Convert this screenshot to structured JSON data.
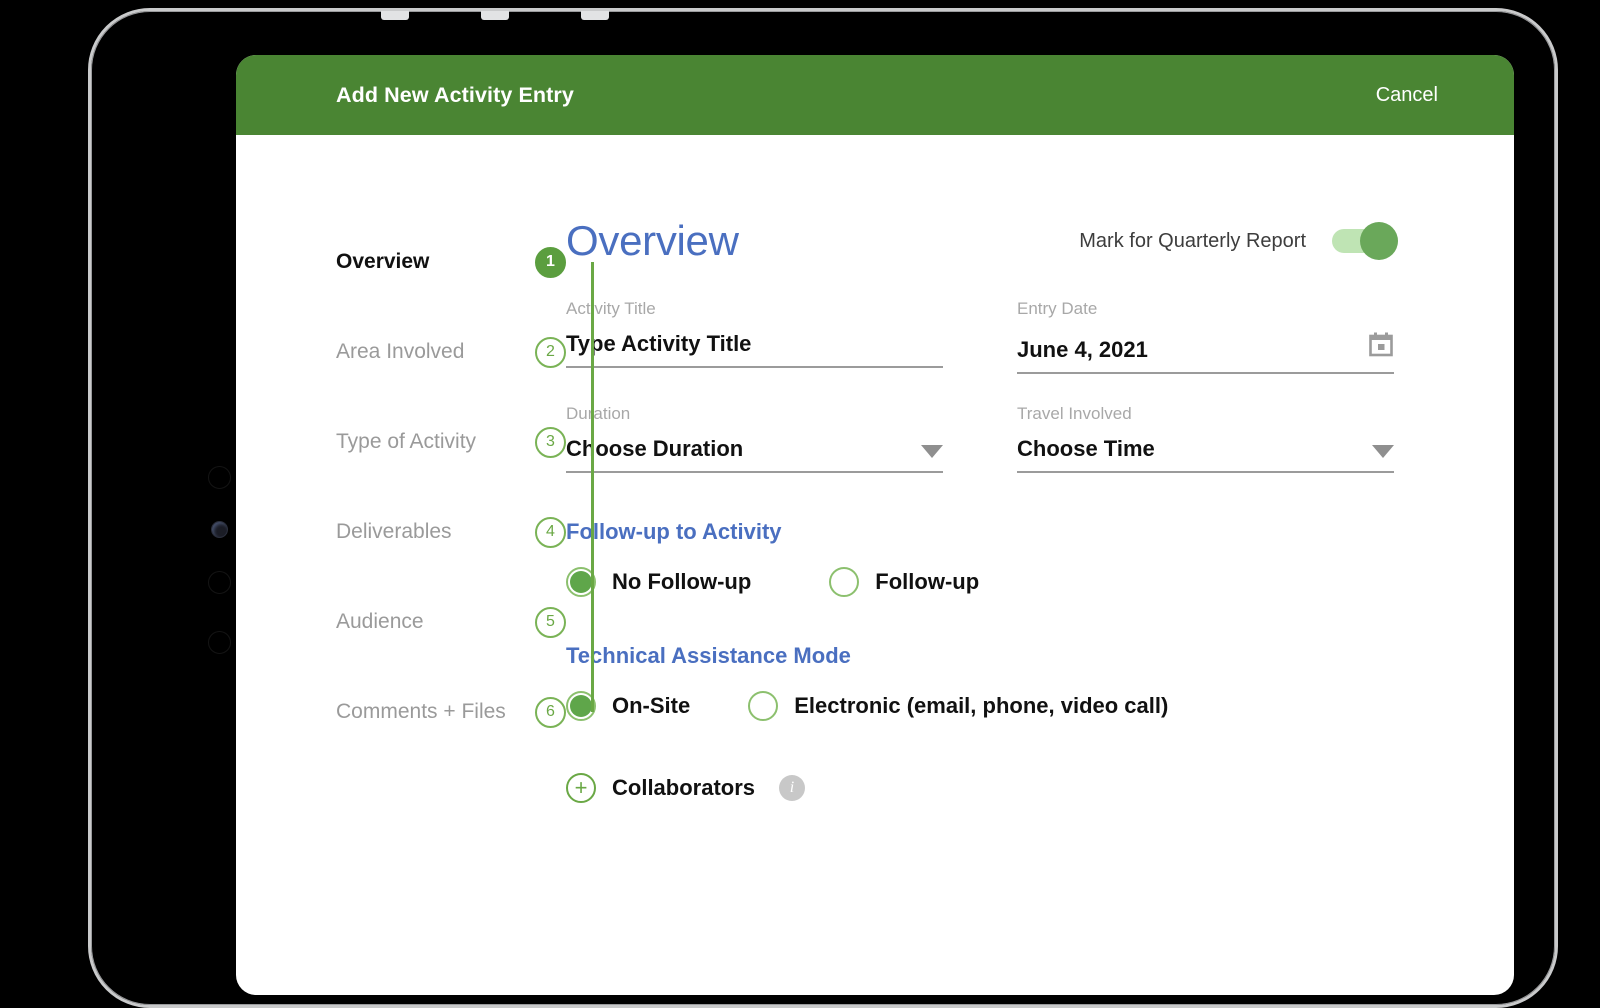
{
  "header": {
    "title": "Add New Activity Entry",
    "cancel_label": "Cancel",
    "background_color": "#4A8533"
  },
  "stepper": {
    "steps": [
      {
        "number": "1",
        "label": "Overview",
        "active": true
      },
      {
        "number": "2",
        "label": "Area Involved",
        "active": false
      },
      {
        "number": "3",
        "label": "Type of Activity",
        "active": false
      },
      {
        "number": "4",
        "label": "Deliverables",
        "active": false
      },
      {
        "number": "5",
        "label": "Audience",
        "active": false
      },
      {
        "number": "6",
        "label": "Comments + Files",
        "active": false
      }
    ],
    "line_color": "#6aa845"
  },
  "main": {
    "heading": "Overview",
    "heading_color": "#4A6FC0",
    "quarterly_report": {
      "label": "Mark for Quarterly Report",
      "enabled": true,
      "track_color": "#bfe4b4",
      "knob_color": "#6aa85a"
    },
    "fields": {
      "activity_title": {
        "label": "Activity Title",
        "value": "",
        "placeholder": "Type Activity Title"
      },
      "entry_date": {
        "label": "Entry Date",
        "value": "June 4, 2021",
        "icon": "calendar-icon"
      },
      "duration": {
        "label": "Duration",
        "value": "Choose Duration",
        "icon": "chevron-down-icon"
      },
      "travel_involved": {
        "label": "Travel Involved",
        "value": "Choose Time",
        "icon": "chevron-down-icon"
      }
    },
    "followup": {
      "title": "Follow-up to Activity",
      "options": [
        {
          "label": "No Follow-up",
          "selected": true
        },
        {
          "label": "Follow-up",
          "selected": false
        }
      ]
    },
    "assistance_mode": {
      "title": "Technical Assistance Mode",
      "options": [
        {
          "label": "On-Site",
          "selected": true
        },
        {
          "label": "Electronic (email, phone, video call)",
          "selected": false
        }
      ]
    },
    "collaborators": {
      "add_icon": "plus-circle-icon",
      "label": "Collaborators",
      "info_icon": "info-icon",
      "info_glyph": "i",
      "plus_glyph": "+"
    }
  }
}
